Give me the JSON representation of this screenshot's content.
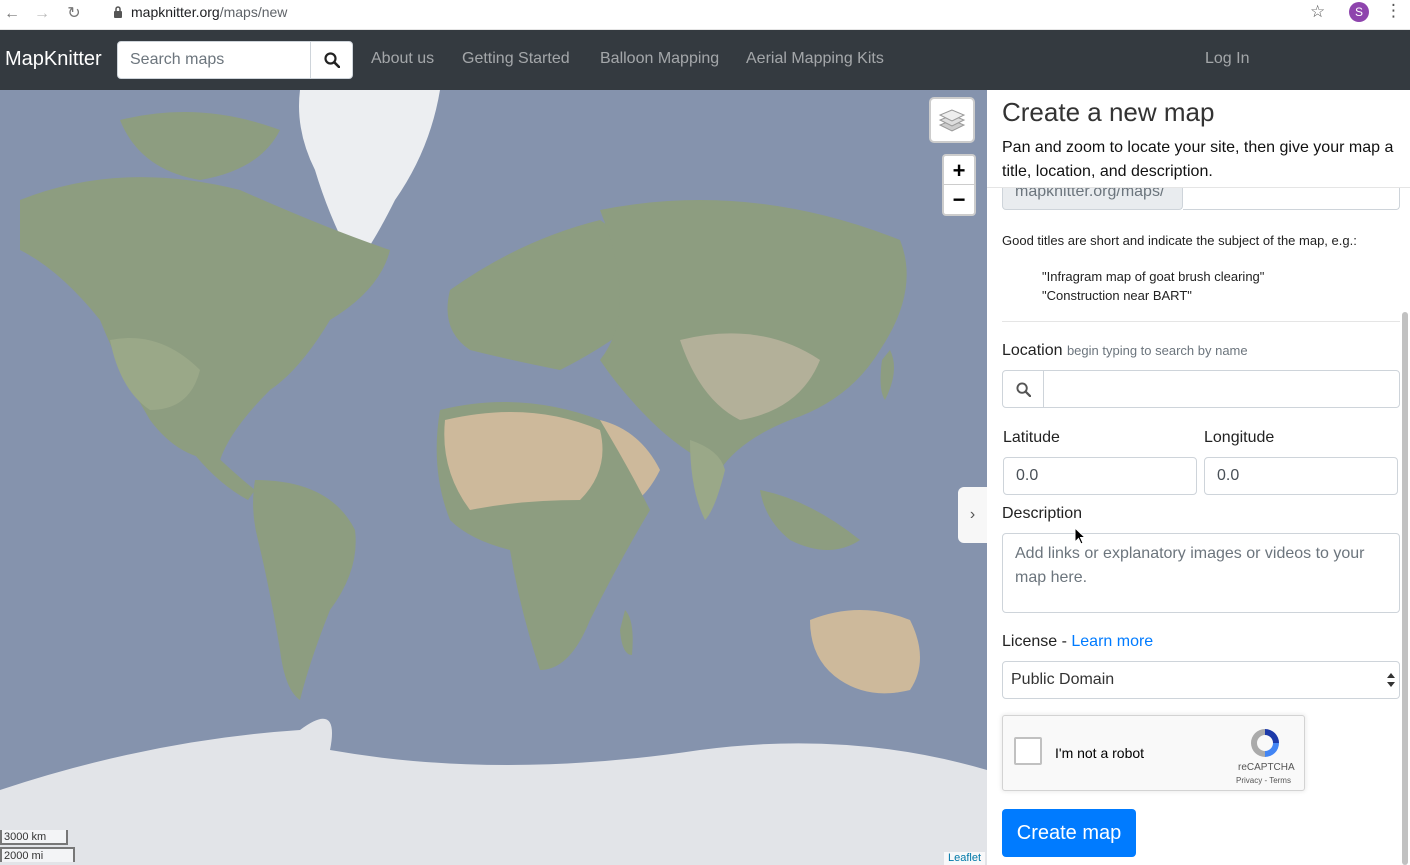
{
  "browser": {
    "url_host": "mapknitter.org",
    "url_path": "/maps/new",
    "profile_initial": "S"
  },
  "navbar": {
    "brand": "MapKnitter",
    "search_placeholder": "Search maps",
    "links": [
      "About us",
      "Getting Started",
      "Balloon Mapping",
      "Aerial Mapping Kits"
    ],
    "login": "Log In"
  },
  "map": {
    "zoom_in": "+",
    "zoom_out": "−",
    "scale_km": "3000 km",
    "scale_mi": "2000 mi",
    "attribution": "Leaflet",
    "sidebar_toggle": "›"
  },
  "panel": {
    "title": "Create a new map",
    "description": "Pan and zoom to locate your site, then give your map a title, location, and description.",
    "slug_prefix": "mapknitter.org/maps/",
    "good_titles": "Good titles are short and indicate the subject of the map, e.g.:",
    "examples": [
      "\"Infragram map of goat brush clearing\"",
      "\"Construction near BART\""
    ],
    "location_label": "Location",
    "location_hint": "begin typing to search by name",
    "latitude_label": "Latitude",
    "latitude_value": "0.0",
    "longitude_label": "Longitude",
    "longitude_value": "0.0",
    "description_label": "Description",
    "description_placeholder": "Add links or explanatory images or videos to your map here.",
    "license_label": "License - ",
    "license_link": "Learn more",
    "license_value": "Public Domain",
    "captcha_text": "I'm not a robot",
    "captcha_brand": "reCAPTCHA",
    "captcha_terms": "Privacy - Terms",
    "submit": "Create map"
  },
  "colors": {
    "navbar_bg": "#343a40",
    "primary": "#007bff",
    "ocean": "#8593ad",
    "land": "#8d9d80",
    "desert": "#cdb99b",
    "ice": "#e2e4e8"
  }
}
